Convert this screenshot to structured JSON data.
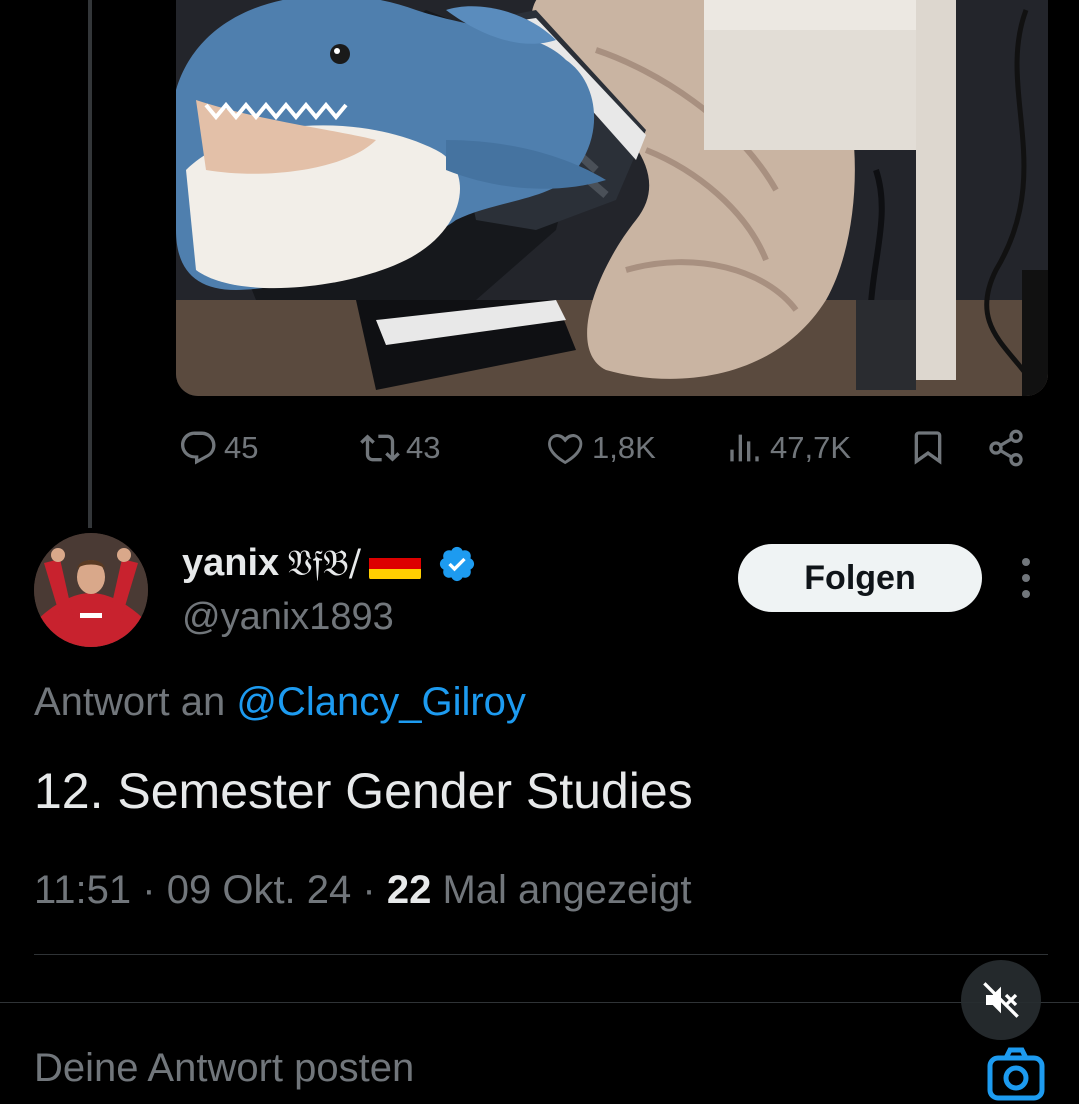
{
  "actions": {
    "replies": "45",
    "reposts": "43",
    "likes": "1,8K",
    "views": "47,7K"
  },
  "author": {
    "display_name": "yanix",
    "club_text": "𝔙𝔣𝔅/",
    "handle": "@yanix1893",
    "verified": true
  },
  "follow_label": "Folgen",
  "reply_to": {
    "prefix": "Antwort an",
    "mention": "@Clancy_Gilroy"
  },
  "tweet_text": "12. Semester Gender Studies",
  "meta": {
    "time": "11:51",
    "separator": "·",
    "date": "09 Okt. 24",
    "views_count": "22",
    "views_label": "Mal angezeigt"
  },
  "reply_placeholder": "Deine Antwort posten",
  "colors": {
    "accent": "#1d9bf0",
    "background": "#000000",
    "muted": "#71767b",
    "text": "#e7e9ea",
    "follow_bg": "#eff3f4"
  }
}
